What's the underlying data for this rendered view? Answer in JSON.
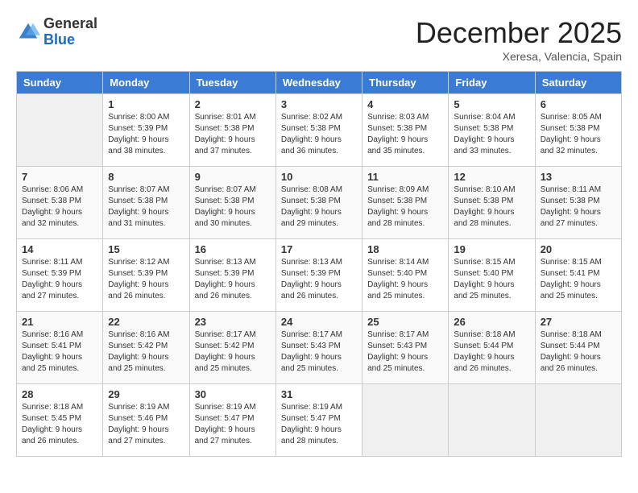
{
  "logo": {
    "general": "General",
    "blue": "Blue"
  },
  "title": "December 2025",
  "location": "Xeresa, Valencia, Spain",
  "days_header": [
    "Sunday",
    "Monday",
    "Tuesday",
    "Wednesday",
    "Thursday",
    "Friday",
    "Saturday"
  ],
  "weeks": [
    [
      {
        "day": "",
        "empty": true
      },
      {
        "day": "1",
        "sunrise": "Sunrise: 8:00 AM",
        "sunset": "Sunset: 5:39 PM",
        "daylight": "Daylight: 9 hours and 38 minutes."
      },
      {
        "day": "2",
        "sunrise": "Sunrise: 8:01 AM",
        "sunset": "Sunset: 5:38 PM",
        "daylight": "Daylight: 9 hours and 37 minutes."
      },
      {
        "day": "3",
        "sunrise": "Sunrise: 8:02 AM",
        "sunset": "Sunset: 5:38 PM",
        "daylight": "Daylight: 9 hours and 36 minutes."
      },
      {
        "day": "4",
        "sunrise": "Sunrise: 8:03 AM",
        "sunset": "Sunset: 5:38 PM",
        "daylight": "Daylight: 9 hours and 35 minutes."
      },
      {
        "day": "5",
        "sunrise": "Sunrise: 8:04 AM",
        "sunset": "Sunset: 5:38 PM",
        "daylight": "Daylight: 9 hours and 33 minutes."
      },
      {
        "day": "6",
        "sunrise": "Sunrise: 8:05 AM",
        "sunset": "Sunset: 5:38 PM",
        "daylight": "Daylight: 9 hours and 32 minutes."
      }
    ],
    [
      {
        "day": "7",
        "sunrise": "Sunrise: 8:06 AM",
        "sunset": "Sunset: 5:38 PM",
        "daylight": "Daylight: 9 hours and 32 minutes."
      },
      {
        "day": "8",
        "sunrise": "Sunrise: 8:07 AM",
        "sunset": "Sunset: 5:38 PM",
        "daylight": "Daylight: 9 hours and 31 minutes."
      },
      {
        "day": "9",
        "sunrise": "Sunrise: 8:07 AM",
        "sunset": "Sunset: 5:38 PM",
        "daylight": "Daylight: 9 hours and 30 minutes."
      },
      {
        "day": "10",
        "sunrise": "Sunrise: 8:08 AM",
        "sunset": "Sunset: 5:38 PM",
        "daylight": "Daylight: 9 hours and 29 minutes."
      },
      {
        "day": "11",
        "sunrise": "Sunrise: 8:09 AM",
        "sunset": "Sunset: 5:38 PM",
        "daylight": "Daylight: 9 hours and 28 minutes."
      },
      {
        "day": "12",
        "sunrise": "Sunrise: 8:10 AM",
        "sunset": "Sunset: 5:38 PM",
        "daylight": "Daylight: 9 hours and 28 minutes."
      },
      {
        "day": "13",
        "sunrise": "Sunrise: 8:11 AM",
        "sunset": "Sunset: 5:38 PM",
        "daylight": "Daylight: 9 hours and 27 minutes."
      }
    ],
    [
      {
        "day": "14",
        "sunrise": "Sunrise: 8:11 AM",
        "sunset": "Sunset: 5:39 PM",
        "daylight": "Daylight: 9 hours and 27 minutes."
      },
      {
        "day": "15",
        "sunrise": "Sunrise: 8:12 AM",
        "sunset": "Sunset: 5:39 PM",
        "daylight": "Daylight: 9 hours and 26 minutes."
      },
      {
        "day": "16",
        "sunrise": "Sunrise: 8:13 AM",
        "sunset": "Sunset: 5:39 PM",
        "daylight": "Daylight: 9 hours and 26 minutes."
      },
      {
        "day": "17",
        "sunrise": "Sunrise: 8:13 AM",
        "sunset": "Sunset: 5:39 PM",
        "daylight": "Daylight: 9 hours and 26 minutes."
      },
      {
        "day": "18",
        "sunrise": "Sunrise: 8:14 AM",
        "sunset": "Sunset: 5:40 PM",
        "daylight": "Daylight: 9 hours and 25 minutes."
      },
      {
        "day": "19",
        "sunrise": "Sunrise: 8:15 AM",
        "sunset": "Sunset: 5:40 PM",
        "daylight": "Daylight: 9 hours and 25 minutes."
      },
      {
        "day": "20",
        "sunrise": "Sunrise: 8:15 AM",
        "sunset": "Sunset: 5:41 PM",
        "daylight": "Daylight: 9 hours and 25 minutes."
      }
    ],
    [
      {
        "day": "21",
        "sunrise": "Sunrise: 8:16 AM",
        "sunset": "Sunset: 5:41 PM",
        "daylight": "Daylight: 9 hours and 25 minutes."
      },
      {
        "day": "22",
        "sunrise": "Sunrise: 8:16 AM",
        "sunset": "Sunset: 5:42 PM",
        "daylight": "Daylight: 9 hours and 25 minutes."
      },
      {
        "day": "23",
        "sunrise": "Sunrise: 8:17 AM",
        "sunset": "Sunset: 5:42 PM",
        "daylight": "Daylight: 9 hours and 25 minutes."
      },
      {
        "day": "24",
        "sunrise": "Sunrise: 8:17 AM",
        "sunset": "Sunset: 5:43 PM",
        "daylight": "Daylight: 9 hours and 25 minutes."
      },
      {
        "day": "25",
        "sunrise": "Sunrise: 8:17 AM",
        "sunset": "Sunset: 5:43 PM",
        "daylight": "Daylight: 9 hours and 25 minutes."
      },
      {
        "day": "26",
        "sunrise": "Sunrise: 8:18 AM",
        "sunset": "Sunset: 5:44 PM",
        "daylight": "Daylight: 9 hours and 26 minutes."
      },
      {
        "day": "27",
        "sunrise": "Sunrise: 8:18 AM",
        "sunset": "Sunset: 5:44 PM",
        "daylight": "Daylight: 9 hours and 26 minutes."
      }
    ],
    [
      {
        "day": "28",
        "sunrise": "Sunrise: 8:18 AM",
        "sunset": "Sunset: 5:45 PM",
        "daylight": "Daylight: 9 hours and 26 minutes."
      },
      {
        "day": "29",
        "sunrise": "Sunrise: 8:19 AM",
        "sunset": "Sunset: 5:46 PM",
        "daylight": "Daylight: 9 hours and 27 minutes."
      },
      {
        "day": "30",
        "sunrise": "Sunrise: 8:19 AM",
        "sunset": "Sunset: 5:47 PM",
        "daylight": "Daylight: 9 hours and 27 minutes."
      },
      {
        "day": "31",
        "sunrise": "Sunrise: 8:19 AM",
        "sunset": "Sunset: 5:47 PM",
        "daylight": "Daylight: 9 hours and 28 minutes."
      },
      {
        "day": "",
        "empty": true
      },
      {
        "day": "",
        "empty": true
      },
      {
        "day": "",
        "empty": true
      }
    ]
  ]
}
